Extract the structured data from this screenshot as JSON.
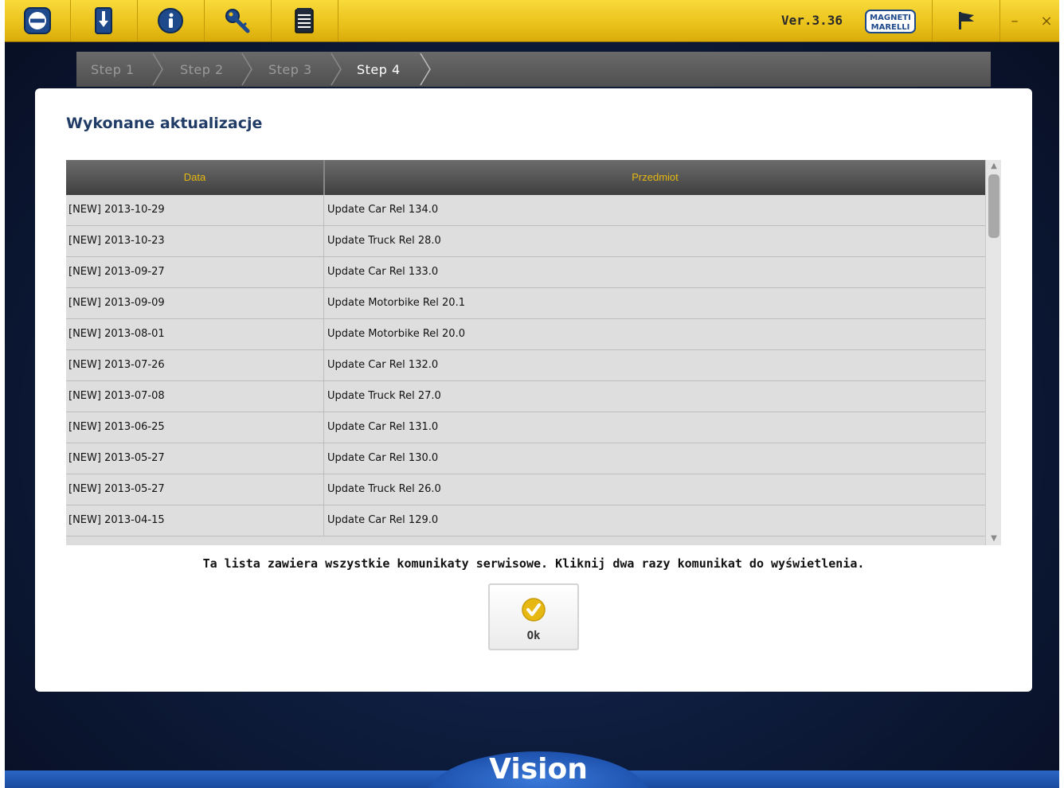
{
  "toolbar": {
    "buttons": [
      {
        "icon": "back-arrow-icon"
      },
      {
        "icon": "update-download-icon"
      },
      {
        "icon": "info-icon"
      },
      {
        "icon": "key-icon"
      },
      {
        "icon": "notepad-icon"
      }
    ],
    "version": "Ver.3.36",
    "brand_logo_text": "MAGNETI MARELLI",
    "flag_icon": "flag-icon",
    "minimize": "–",
    "close": "×",
    "accent": "#eac11a"
  },
  "steps": [
    {
      "label": "Step 1",
      "active": false
    },
    {
      "label": "Step 2",
      "active": false
    },
    {
      "label": "Step 3",
      "active": false
    },
    {
      "label": "Step 4",
      "active": true
    }
  ],
  "dialog": {
    "title": "Wykonane aktualizacje",
    "columns": [
      "Data",
      "Przedmiot"
    ],
    "rows": [
      {
        "date": "[NEW] 2013-10-29",
        "subject": "Update Car Rel 134.0"
      },
      {
        "date": "[NEW] 2013-10-23",
        "subject": "Update Truck Rel 28.0"
      },
      {
        "date": "[NEW] 2013-09-27",
        "subject": "Update Car Rel 133.0"
      },
      {
        "date": "[NEW] 2013-09-09",
        "subject": "Update Motorbike Rel 20.1"
      },
      {
        "date": "[NEW] 2013-08-01",
        "subject": "Update Motorbike Rel 20.0"
      },
      {
        "date": "[NEW] 2013-07-26",
        "subject": "Update Car Rel 132.0"
      },
      {
        "date": "[NEW] 2013-07-08",
        "subject": "Update Truck Rel 27.0"
      },
      {
        "date": "[NEW] 2013-06-25",
        "subject": "Update Car Rel 131.0"
      },
      {
        "date": "[NEW] 2013-05-27",
        "subject": "Update Car Rel 130.0"
      },
      {
        "date": "[NEW] 2013-05-27",
        "subject": "Update Truck Rel 26.0"
      },
      {
        "date": "[NEW] 2013-04-15",
        "subject": "Update Car Rel 129.0"
      }
    ],
    "info_text": "Ta lista zawiera wszystkie komunikaty serwisowe. Kliknij dwa razy komunikat do wyświetlenia.",
    "ok_label": "Ok"
  },
  "footer": {
    "brand": "Vision"
  }
}
